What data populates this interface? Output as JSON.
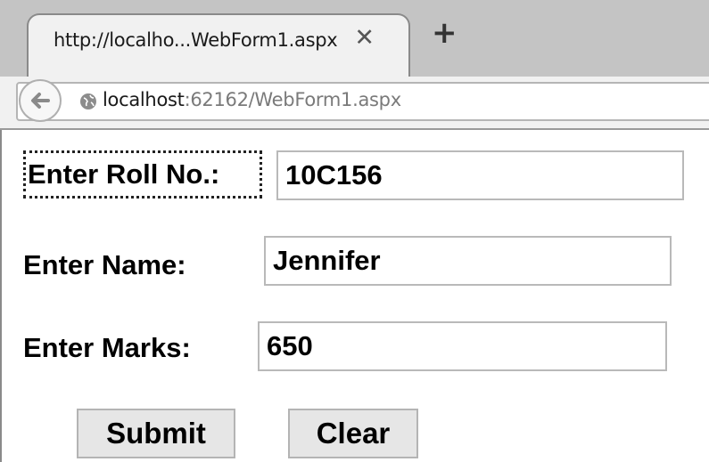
{
  "browser": {
    "tab_title": "http://localho...WebForm1.aspx",
    "tab_close_glyph": "✕",
    "new_tab_glyph": "+",
    "url_host": "localhost",
    "url_rest": ":62162/WebForm1.aspx"
  },
  "form": {
    "roll_label": "Enter Roll No.:",
    "roll_value": "10C156",
    "name_label": "Enter Name:",
    "name_value": "Jennifer",
    "marks_label": "Enter Marks:",
    "marks_value": "650",
    "submit_label": "Submit",
    "clear_label": "Clear"
  }
}
